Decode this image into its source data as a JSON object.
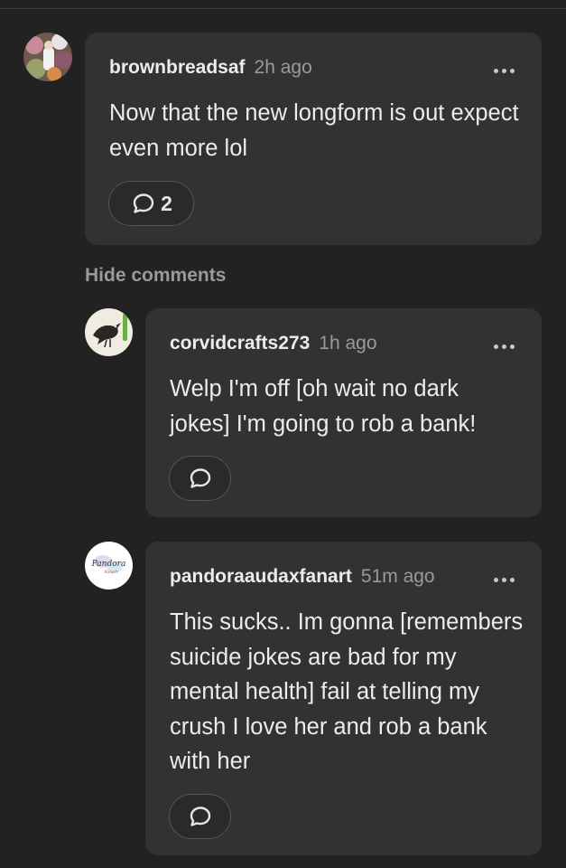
{
  "hide_comments_label": "Hide comments",
  "comments": [
    {
      "username": "brownbreadsaf",
      "time": "2h ago",
      "text": "Now that the new longform is out expect even more lol",
      "reply_count": "2",
      "avatar": "floral-photo-avatar"
    },
    {
      "username": "corvidcrafts273",
      "time": "1h ago",
      "text": "Welp I'm off [oh wait no dark jokes] I'm going to rob a bank!",
      "reply_count": "",
      "avatar": "crow-avatar"
    },
    {
      "username": "pandoraaudaxfanart",
      "time": "51m ago",
      "text": "This sucks..  Im gonna [remembers suicide jokes are bad for my mental health] fail at telling my crush I love her and rob a bank with her",
      "reply_count": "",
      "avatar": "pandora-logo-avatar",
      "avatar_text_line1": "Pandora",
      "avatar_text_line2": "Fanart"
    }
  ]
}
